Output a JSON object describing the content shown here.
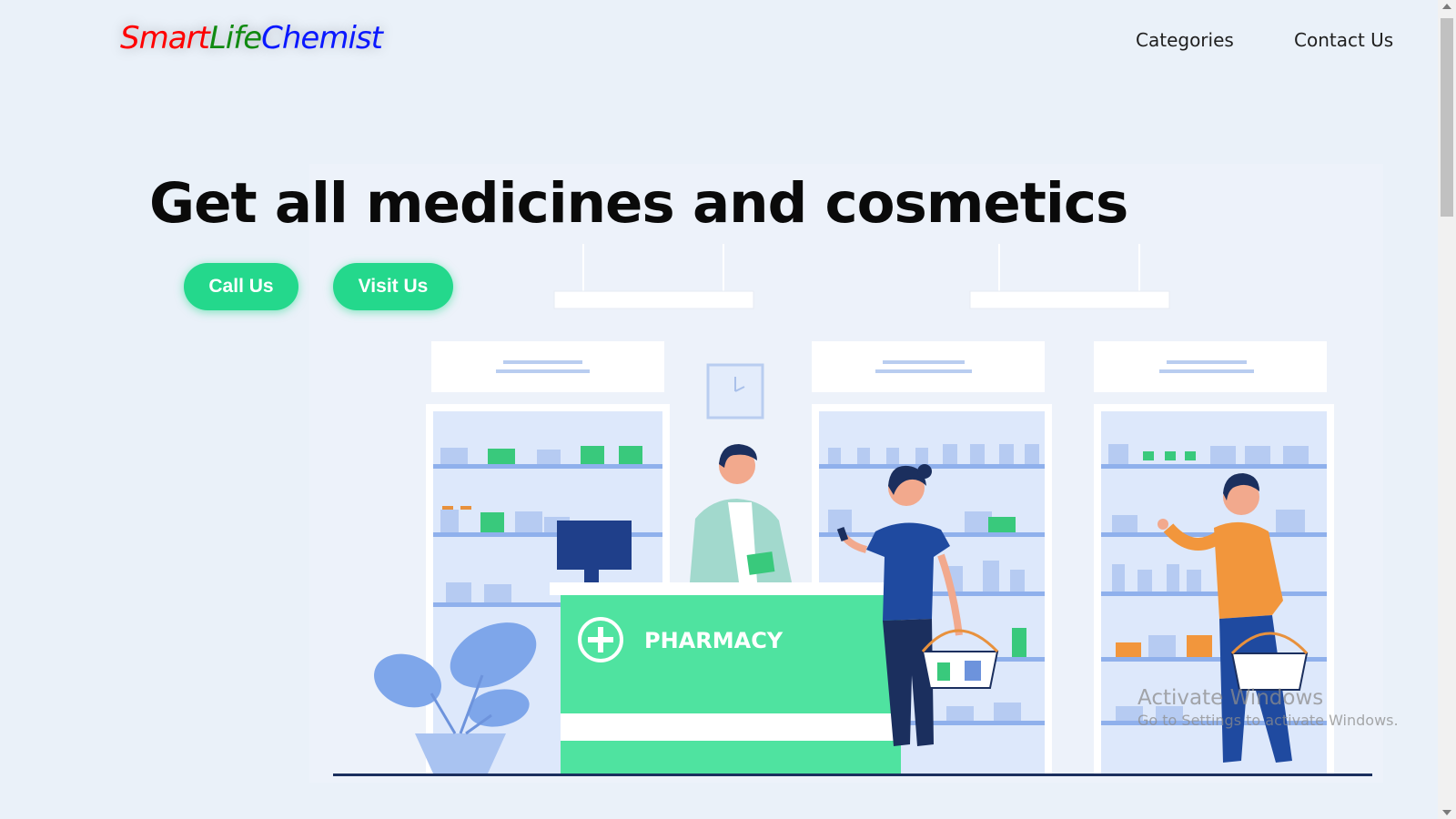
{
  "brand": {
    "part1": "Smart",
    "part2": "Life",
    "part3": "Chemist",
    "color1": "#ff0000",
    "color2": "#118a11",
    "color3": "#0a18ff"
  },
  "nav": {
    "categories": "Categories",
    "contact": "Contact Us"
  },
  "hero": {
    "title": "Get all medicines and cosmetics",
    "call_label": "Call Us",
    "visit_label": "Visit Us",
    "accent_color": "#24d88c"
  },
  "illustration": {
    "counter_label": "PHARMACY"
  },
  "watermark": {
    "line1": "Activate Windows",
    "line2": "Go to Settings to activate Windows."
  }
}
